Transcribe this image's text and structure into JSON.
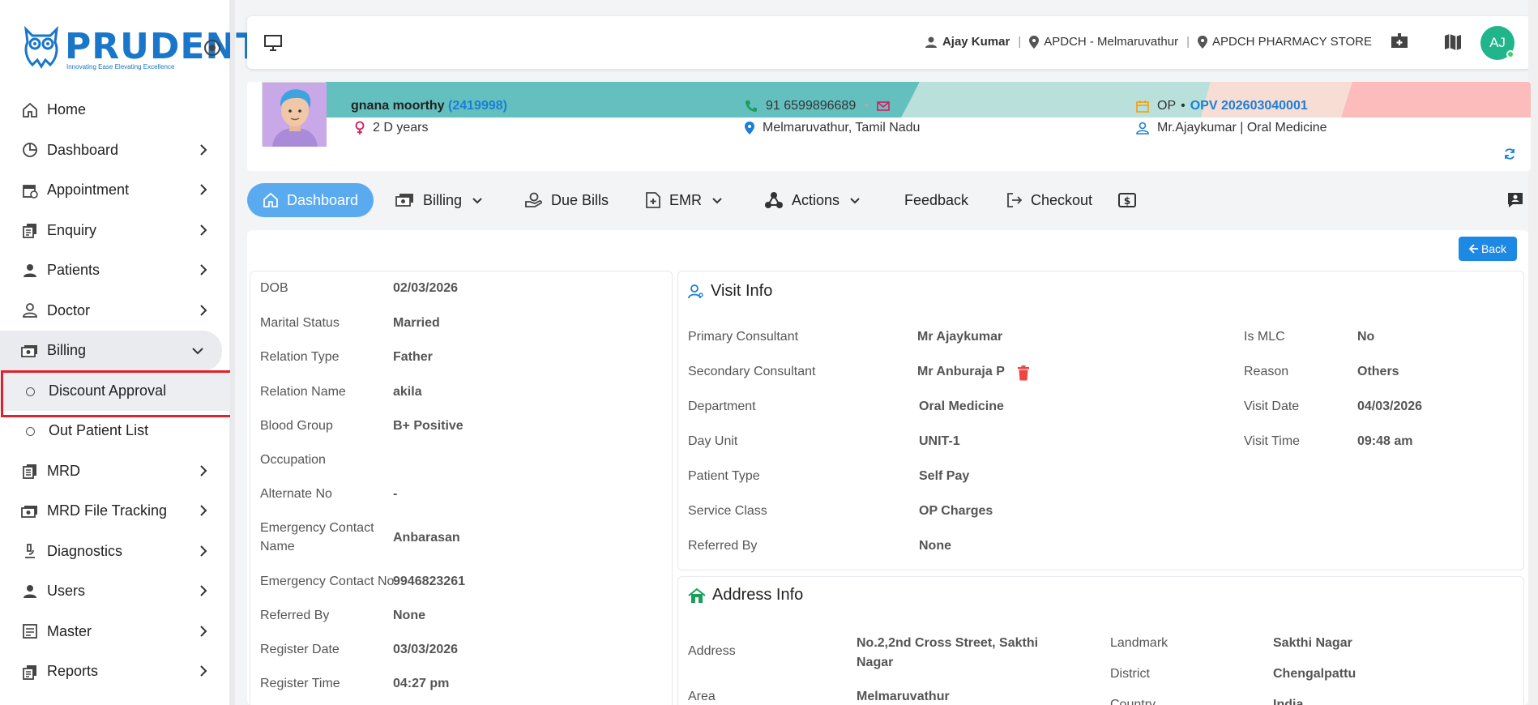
{
  "brand": {
    "name": "PRUDENT",
    "tagline": "Innovating Ease Elevating Excellence"
  },
  "sidebar": {
    "items": [
      {
        "label": "Home",
        "icon": "home-icon"
      },
      {
        "label": "Dashboard",
        "icon": "pie-chart-icon"
      },
      {
        "label": "Appointment",
        "icon": "calendar-clock-icon"
      },
      {
        "label": "Enquiry",
        "icon": "copy-icon"
      },
      {
        "label": "Patients",
        "icon": "person-icon"
      },
      {
        "label": "Doctor",
        "icon": "doctor-icon"
      },
      {
        "label": "Billing",
        "icon": "cash-icon"
      },
      {
        "label": "MRD",
        "icon": "document-icon"
      },
      {
        "label": "MRD File Tracking",
        "icon": "cash-icon"
      },
      {
        "label": "Diagnostics",
        "icon": "microscope-icon"
      },
      {
        "label": "Users",
        "icon": "person-icon"
      },
      {
        "label": "Master",
        "icon": "list-icon"
      },
      {
        "label": "Reports",
        "icon": "copy-icon"
      }
    ],
    "billing_sub": [
      "Discount Approval",
      "Out Patient List"
    ]
  },
  "topbar": {
    "user": "Ajay Kumar",
    "branch": "APDCH - Melmaruvathur",
    "store": "APDCH PHARMACY STORE",
    "avatar": "AJ"
  },
  "patient": {
    "name": "gnana moorthy",
    "id": "(2419998)",
    "age": "2 D years",
    "phone": "91 6599896689",
    "location": "Melmaruvathur, Tamil Nadu",
    "op_label": "OP",
    "op_number": "OPV 202603040001",
    "consultant": "Mr.Ajaykumar | Oral Medicine"
  },
  "tabs": [
    "Dashboard",
    "Billing",
    "Due Bills",
    "EMR",
    "Actions",
    "Feedback",
    "Checkout"
  ],
  "back_label": "Back",
  "personal": [
    {
      "label": "DOB",
      "value": "02/03/2026"
    },
    {
      "label": "Marital Status",
      "value": "Married"
    },
    {
      "label": "Relation Type",
      "value": "Father"
    },
    {
      "label": "Relation Name",
      "value": "akila"
    },
    {
      "label": "Blood Group",
      "value": "B+ Positive"
    },
    {
      "label": "Occupation",
      "value": ""
    },
    {
      "label": "Alternate No",
      "value": "-"
    },
    {
      "label": "Emergency Contact",
      "label2": "Name",
      "value": "Anbarasan"
    },
    {
      "label": "Emergency Contact No",
      "value": "9946823261"
    },
    {
      "label": "Referred By",
      "value": "None"
    },
    {
      "label": "Register Date",
      "value": "03/03/2026"
    },
    {
      "label": "Register Time",
      "value": "04:27 pm"
    }
  ],
  "visit": {
    "title": "Visit Info",
    "left": [
      {
        "label": "Primary Consultant",
        "value": "Mr Ajaykumar"
      },
      {
        "label": "Secondary Consultant",
        "value": "Mr Anburaja P"
      },
      {
        "label": "Department",
        "value": "Oral Medicine"
      },
      {
        "label": "Day Unit",
        "value": "UNIT-1"
      },
      {
        "label": "Patient Type",
        "value": "Self Pay"
      },
      {
        "label": "Service Class",
        "value": "OP Charges"
      },
      {
        "label": "Referred By",
        "value": "None"
      }
    ],
    "right": [
      {
        "label": "Is MLC",
        "value": "No"
      },
      {
        "label": "Reason",
        "value": "Others"
      },
      {
        "label": "Visit Date",
        "value": "04/03/2026"
      },
      {
        "label": "Visit Time",
        "value": "09:48 am"
      }
    ]
  },
  "address": {
    "title": "Address Info",
    "address_label": "Address",
    "address_line1": "No.2,2nd Cross Street, Sakthi",
    "address_line2": "Nagar",
    "area_label": "Area",
    "area_value": "Melmaruvathur",
    "landmark_label": "Landmark",
    "landmark_value": "Sakthi Nagar",
    "district_label": "District",
    "district_value": "Chengalpattu",
    "country_label": "Country",
    "country_value": "India"
  },
  "colors": {
    "accent": "#1e88e5",
    "active_tab": "#5aaaf0",
    "highlight_border": "#e0202a"
  }
}
